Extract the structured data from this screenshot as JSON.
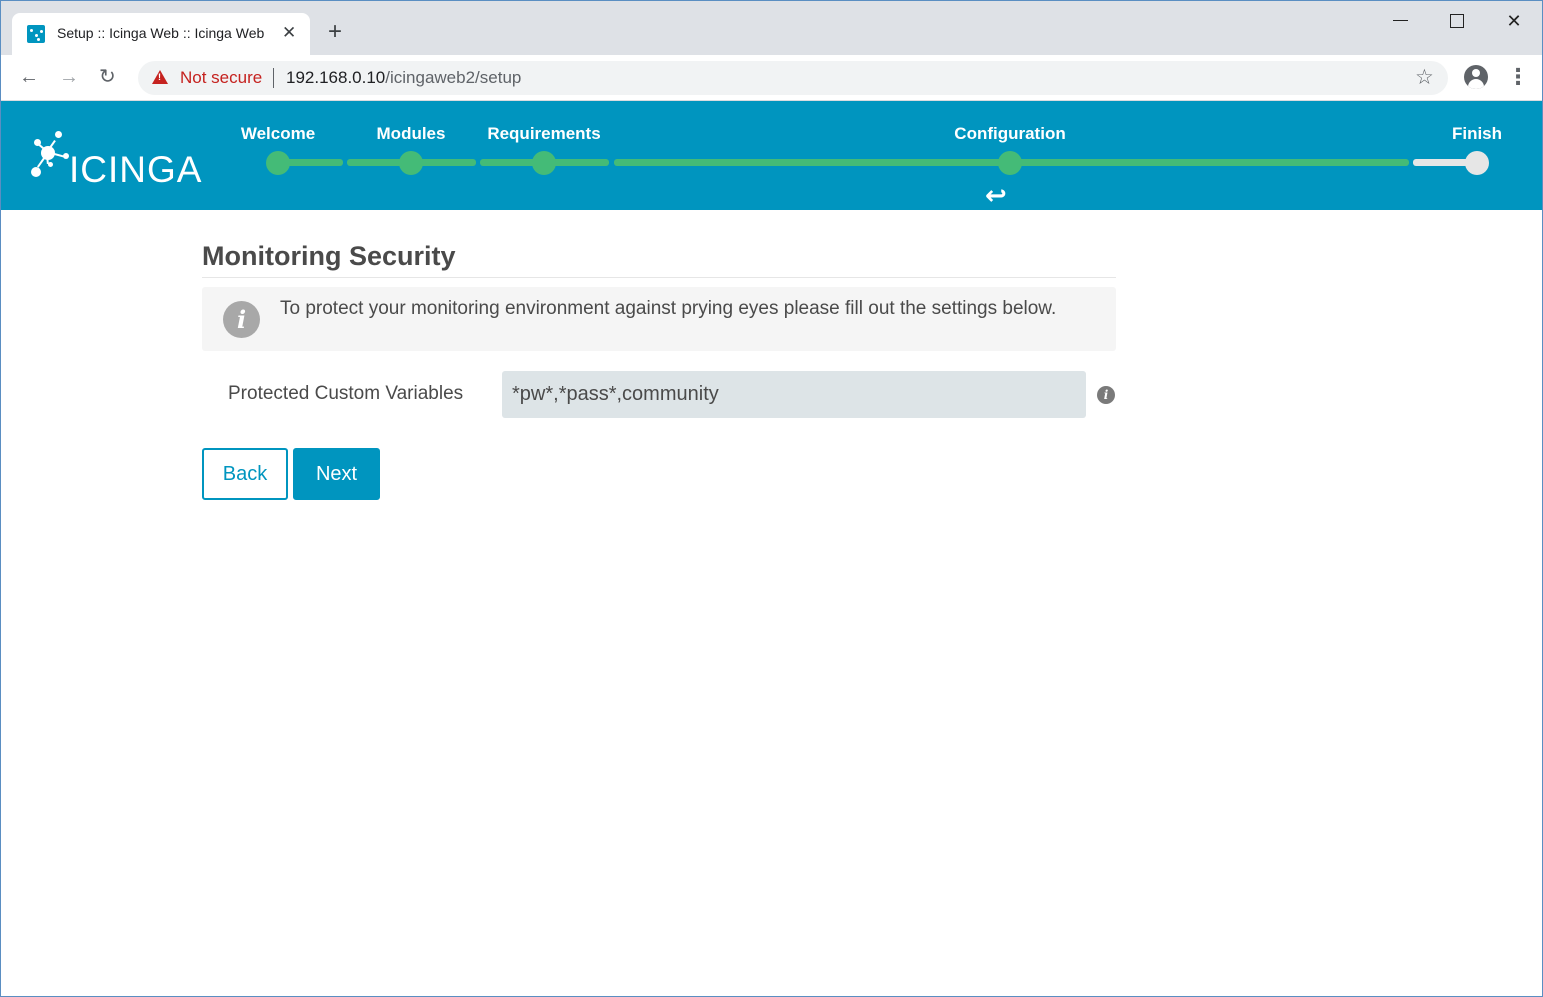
{
  "browser": {
    "tab_title": "Setup :: Icinga Web :: Icinga Web",
    "tab_close": "✕",
    "new_tab": "+",
    "security_label": "Not secure",
    "url_host": "192.168.0.10",
    "url_path": "/icingaweb2/setup"
  },
  "header": {
    "logo_text": "ICINGA",
    "steps": [
      {
        "label": "Welcome",
        "state": "done"
      },
      {
        "label": "Modules",
        "state": "done"
      },
      {
        "label": "Requirements",
        "state": "done"
      },
      {
        "label": "Configuration",
        "state": "current"
      },
      {
        "label": "Finish",
        "state": "pending"
      }
    ]
  },
  "page": {
    "title": "Monitoring Security",
    "notice": "To protect your monitoring environment against prying eyes please fill out the settings below.",
    "field_label": "Protected Custom Variables",
    "field_value": "*pw*,*pass*,community",
    "back_label": "Back",
    "next_label": "Next"
  },
  "colors": {
    "brand": "#0095bf",
    "progress_done": "#44bb77",
    "progress_pending": "#e6e6e6",
    "warning": "#c5221f"
  }
}
